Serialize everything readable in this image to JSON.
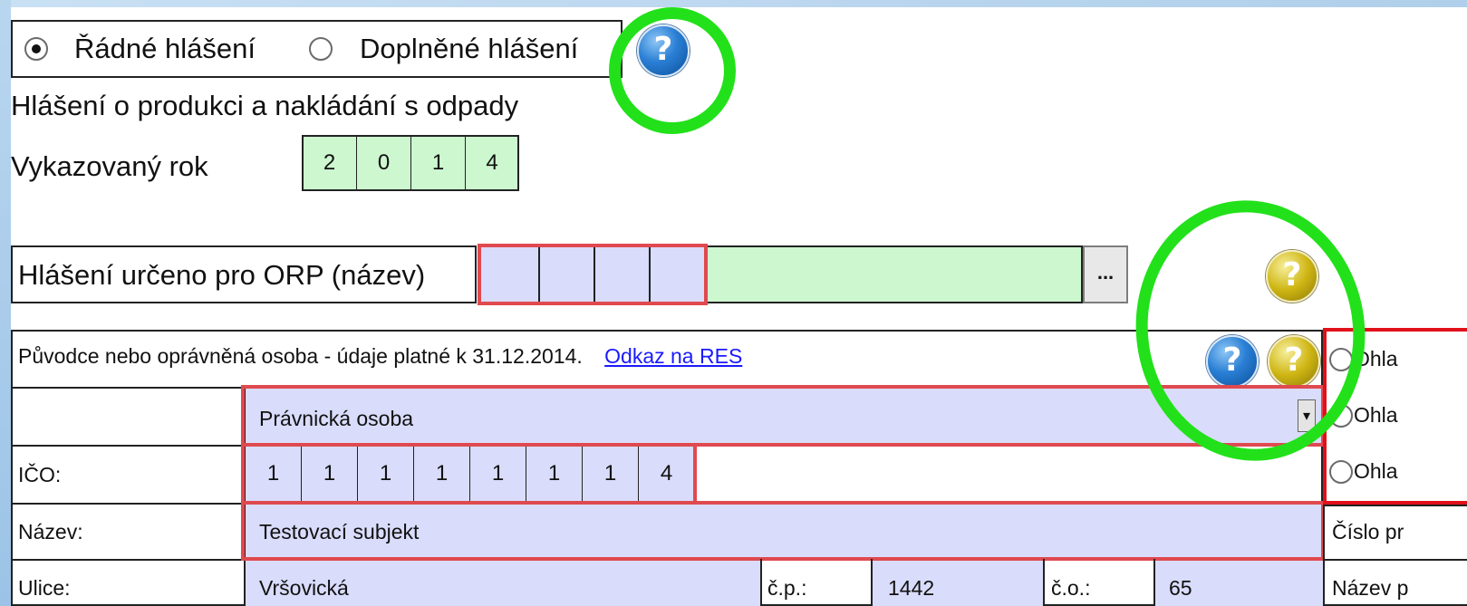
{
  "report_type": {
    "option_regular": "Řádné hlášení",
    "option_supplementary": "Doplněné hlášení",
    "selected": "regular"
  },
  "form_title": "Hlášení o produkci a nakládání s odpady",
  "year": {
    "label": "Vykazovaný rok",
    "digits": [
      "2",
      "0",
      "1",
      "4"
    ]
  },
  "orp": {
    "label": "Hlášení určeno pro ORP (název)",
    "browse_label": "..."
  },
  "originator": {
    "header_text": "Původce nebo oprávněná osoba - údaje platné k 31.12.2014.",
    "res_link": "Odkaz na RES",
    "person_type": "Právnická osoba",
    "ico_label": "IČO:",
    "ico_digits": [
      "1",
      "1",
      "1",
      "1",
      "1",
      "1",
      "1",
      "4"
    ],
    "name_label": "Název:",
    "name_value": "Testovací subjekt",
    "street_label": "Ulice:",
    "street_value": "Vršovická",
    "cp_label": "č.p.:",
    "cp_value": "1442",
    "co_label": "č.o.:",
    "co_value": "65"
  },
  "right_panel": {
    "radio_1": "Ohla",
    "radio_2": "Ohla",
    "radio_3": "Ohla",
    "number_label": "Číslo pr",
    "name_label": "Název p"
  },
  "icons": {
    "help_blue": "?",
    "help_yellow": "?",
    "dropdown": "▾"
  },
  "colors": {
    "annotation_ring": "#22e11a",
    "required_border": "#e0494f",
    "field_lavender": "#d9dcfa",
    "field_mint": "#ccf7cf",
    "link": "#1a1aff"
  }
}
